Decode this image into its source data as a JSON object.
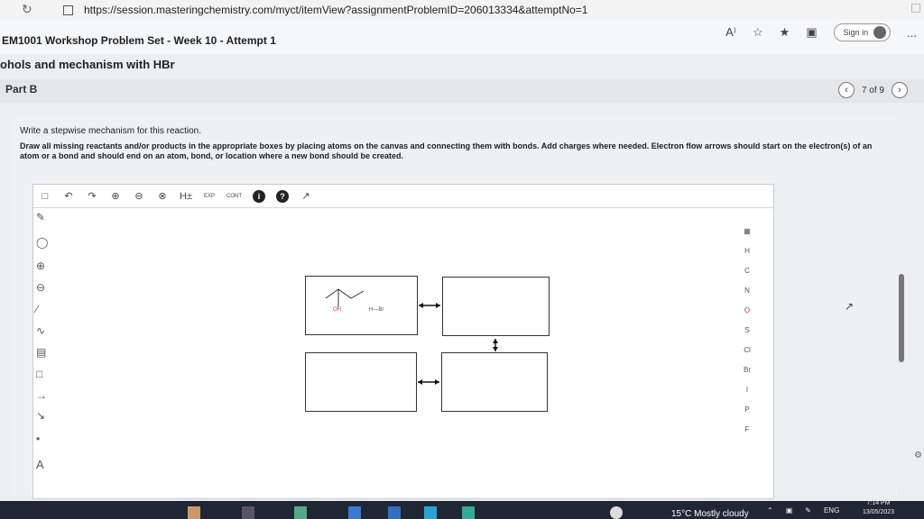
{
  "browser": {
    "url": "https://session.masteringchemistry.com/myct/itemView?assignmentProblemID=206013334&attemptNo=1",
    "sign_in": "Sign in",
    "reader_icon": "read-aloud-icon",
    "more": "..."
  },
  "assignment": {
    "title": "EM1001 Workshop Problem Set - Week 10 - Attempt 1"
  },
  "problem": {
    "title": "ohols and mechanism with HBr",
    "part": "Part B",
    "pager": "7 of 9"
  },
  "instructions": {
    "line1": "Write a stepwise mechanism for this reaction.",
    "line2": "Draw all missing reactants and/or products in the appropriate boxes by placing atoms on the canvas and connecting them with bonds. Add charges where needed. Electron flow arrows should start on the electron(s) of an atom or a bond and should end on an atom, bond, or location where a new bond should be created."
  },
  "sketcher": {
    "toolbar": {
      "h_toggle": "H±",
      "exp": "EXP",
      "cont": "CONT"
    },
    "reactant_labels": {
      "oh": "OH",
      "hbr": "H—Br"
    },
    "atoms": [
      "H",
      "C",
      "N",
      "O",
      "S",
      "Cl",
      "Br",
      "I",
      "P",
      "F"
    ],
    "text_tool": "A"
  },
  "taskbar": {
    "weather": "15°C  Mostly cloudy",
    "lang": "ENG",
    "time": "7:14 PM",
    "date": "13/05/2023"
  }
}
